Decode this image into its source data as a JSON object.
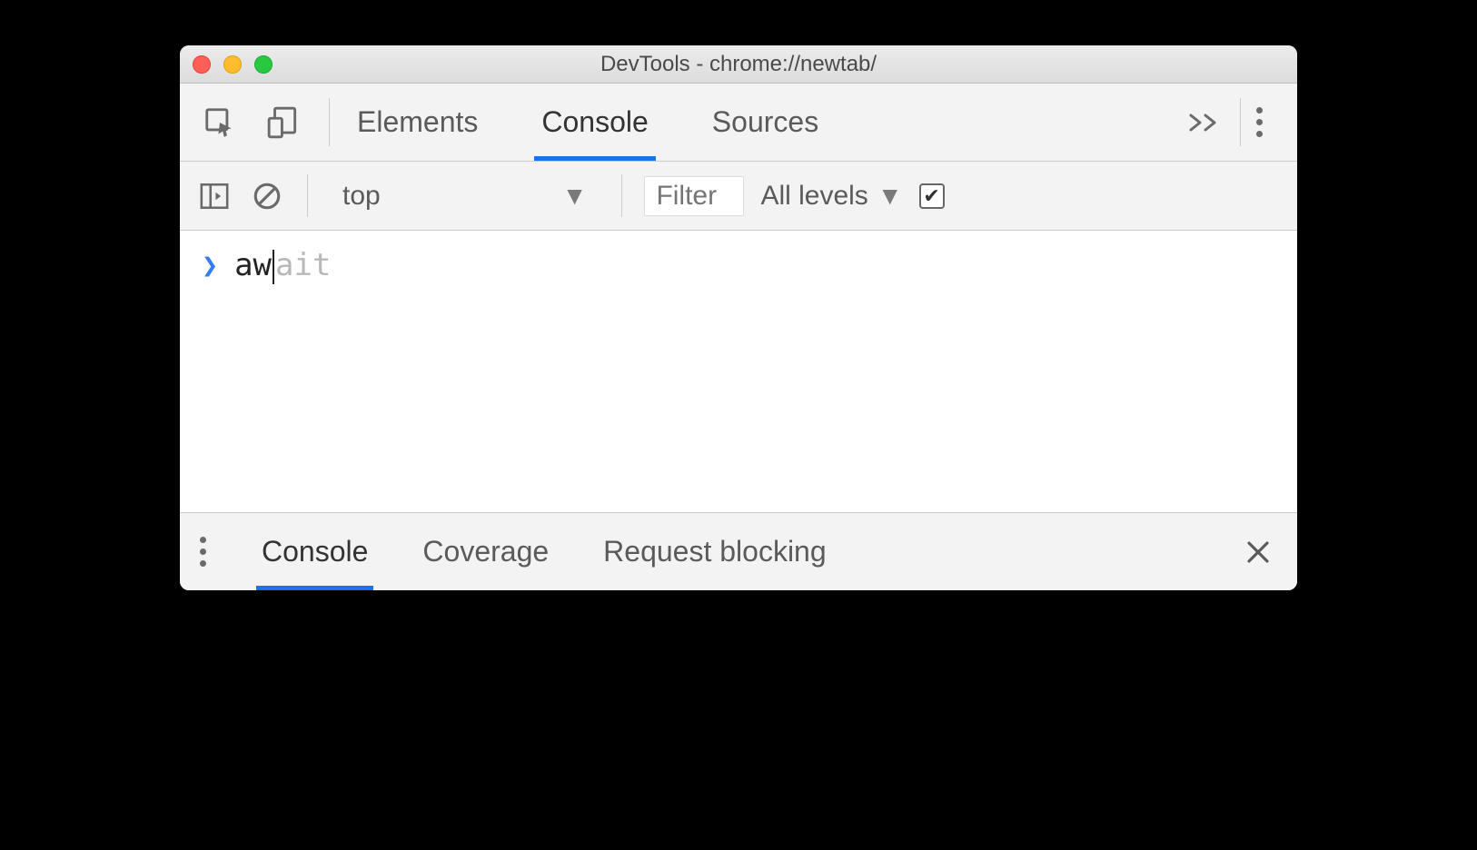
{
  "window": {
    "title": "DevTools - chrome://newtab/"
  },
  "mainTabs": {
    "items": [
      "Elements",
      "Console",
      "Sources"
    ],
    "activeIndex": 1
  },
  "consoleToolbar": {
    "context": "top",
    "filterPlaceholder": "Filter",
    "levelsLabel": "All levels",
    "groupSimilarChecked": true
  },
  "consoleInput": {
    "typed": "aw",
    "suggestionRemainder": "ait"
  },
  "drawer": {
    "tabs": [
      "Console",
      "Coverage",
      "Request blocking"
    ],
    "activeIndex": 0
  }
}
